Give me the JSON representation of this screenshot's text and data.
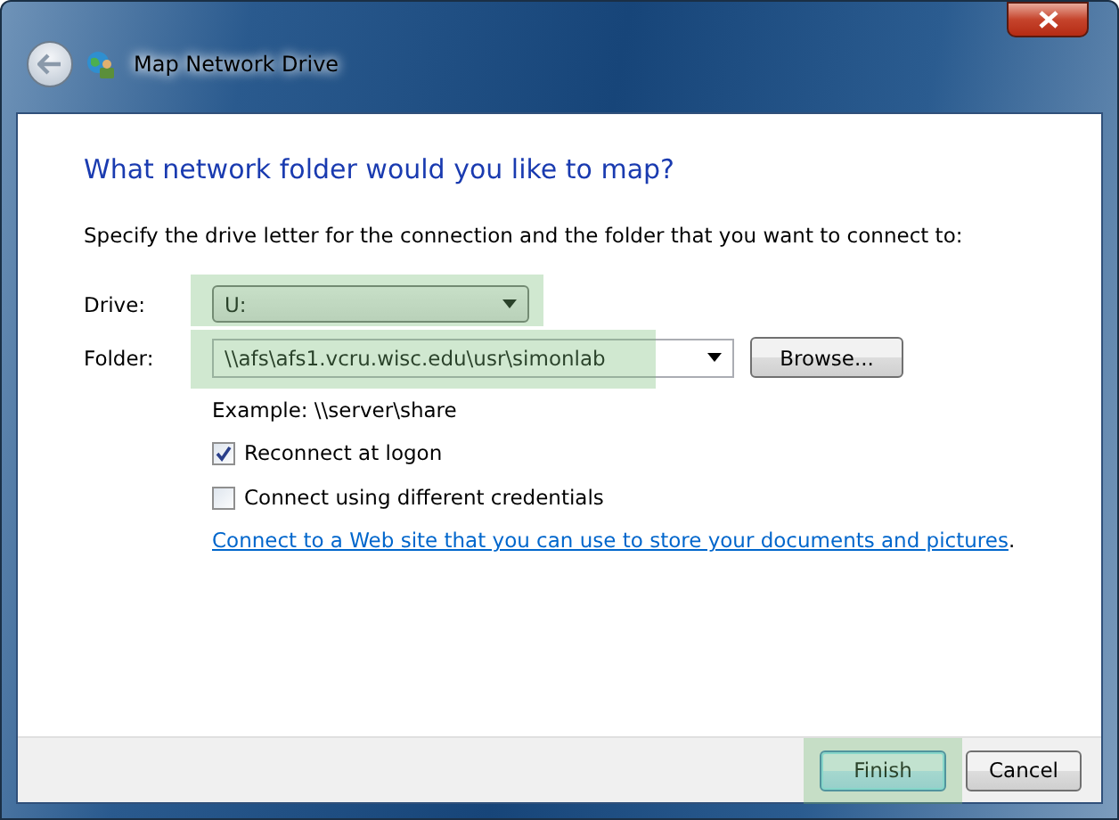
{
  "window": {
    "title": "Map Network Drive"
  },
  "heading": "What network folder would you like to map?",
  "instruction": "Specify the drive letter for the connection and the folder that you want to connect to:",
  "drive": {
    "label": "Drive:",
    "value": "U:",
    "highlighted": true
  },
  "folder": {
    "label": "Folder:",
    "value": "\\\\afs\\afs1.vcru.wisc.edu\\usr\\simonlab",
    "highlighted": true,
    "browse": "Browse..."
  },
  "example": "Example: \\\\server\\share",
  "options": [
    {
      "label": "Reconnect at logon",
      "checked": true
    },
    {
      "label": "Connect using different credentials",
      "checked": false
    }
  ],
  "link": "Connect to a Web site that you can use to store your documents and pictures",
  "link_suffix": ".",
  "buttons": [
    {
      "label": "Finish",
      "kind": "primary",
      "highlighted": true
    },
    {
      "label": "Cancel",
      "kind": "normal",
      "highlighted": false
    }
  ]
}
